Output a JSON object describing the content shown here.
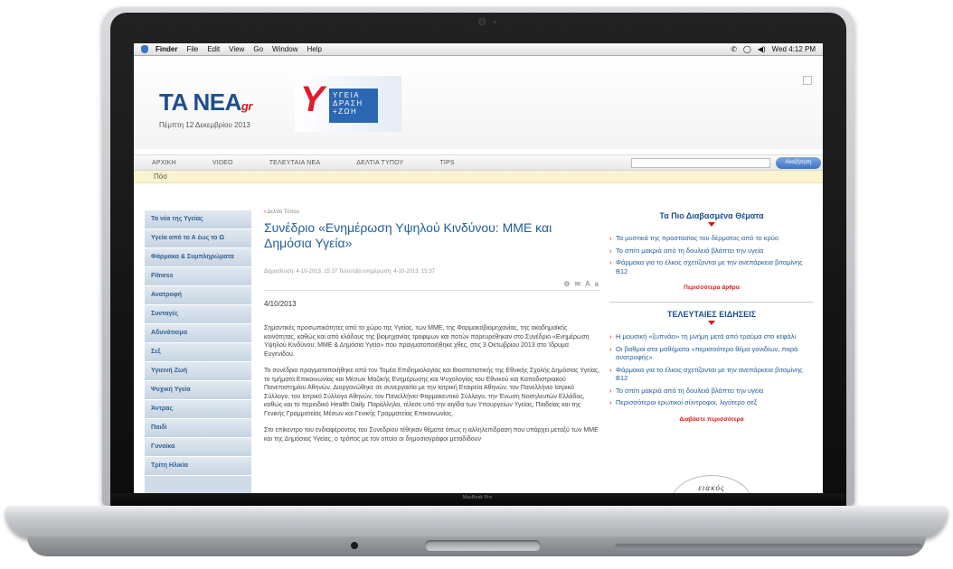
{
  "menubar": {
    "items": [
      "Finder",
      "File",
      "Edit",
      "View",
      "Go",
      "Window",
      "Help"
    ],
    "clock": "Wed 4:12 PM"
  },
  "site": {
    "logo": "TA NEA",
    "logo_suffix": "gr",
    "date": "Πέμπτη 12 Δεκεμβρίου 2013",
    "banner_letter": "Υ",
    "banner_lines": [
      "ΥΓΕΙΑ",
      "ΔΡΑΣΗ",
      "+ΖΩΗ"
    ]
  },
  "nav": {
    "items": [
      "ΑΡΧΙΚΗ",
      "VIDEO",
      "ΤΕΛΕΥΤΑΙΑ ΝΕΑ",
      "ΔΕΛΤΙΑ ΤΥΠΟΥ",
      "TIPS"
    ],
    "search_button": "Αναζήτηση",
    "subnav": "Πόσ"
  },
  "sidebar": {
    "items": [
      "Τα νέα της Υγείας",
      "Υγεία από το Α έως το Ω",
      "Φάρμακα & Συμπληρώματα",
      "Fitness",
      "Ανατροφή",
      "Συνταγές",
      "Αδυνάτισμα",
      "Σεξ",
      "Υγιεινή Ζωή",
      "Ψυχική Υγεία",
      "Άντρας",
      "Παιδί",
      "Γυναίκα",
      "Τρίτη Ηλικία"
    ]
  },
  "article": {
    "crumb": "Δελτία Τύπου",
    "title": "Συνέδριο «Ενημέρωση Υψηλού Κινδύνου: ΜΜΕ και Δημόσια Υγεία»",
    "meta": "Δημοσίευση: 4-10-2013, 15:37 Τελευταία ενημέρωση: 4-10-2013, 15:37",
    "date": "4/10/2013",
    "paragraphs": [
      "Σημαντικές προσωπικότητες από το χώρο της Υγείας, των ΜΜΕ, της Φαρμακοβιομηχανίας, της ακαδημαϊκής κοινότητας, καθώς και από κλάδους της βιομηχανίας τροφίμων και ποτών παρευρέθηκαν στο Συνέδριο «Ενημέρωση Υψηλού Κινδύνου: ΜΜΕ & Δημόσια Υγεία» που πραγματοποιήθηκε χθες, στις 3 Οκτωβρίου 2013 στο Ίδρυμα Ευγενίδου.",
      "Το συνέδριο πραγματοποιήθηκε από τον Τομέα Επιδημιολογίας και Βιοστατιστικής της Εθνικής Σχολής Δημόσιας Υγείας, το τμήματα Επικοινωνίας και Μέσων Μαζικής Ενημέρωσης και Ψυχολογίας του Εθνικού και Καποδιστριακού Πανεπιστημίου Αθηνών. Διοργανώθηκε σε συνεργασία με την Ιατρική Εταιρεία Αθηνών, τον Πανελλήνιο Ιατρικό Σύλλογο, τον Ιατρικό Σύλλογο Αθηνών, τον Πανελλήνιο Φαρμακευτικό Σύλλογο, την Ένωση Νοσηλευτών Ελλάδος, καθώς και το περιοδικό Health Daily. Παράλληλα, τέλεσε υπό την αιγίδα των Υπουργείων Υγείας, Παιδείας και της Γενικής Γραμματείας Μέσων και Γενικής Γραμματείας Επικοινωνίας.",
      "Στο επίκεντρο του ενδιαφέροντος του Συνεδρίου τέθηκαν θέματα όπως η αλληλεπίδραση που υπάρχει μεταξύ των ΜΜΕ και της Δημόσιας Υγείας, ο τρόπος με τον οποίο οι δημοσιογράφοι μεταδίδουν"
    ]
  },
  "popular": {
    "title": "Τα Πιο Διαβασμένα Θέματα",
    "items": [
      "Τα μυστικά της προστασίας του δέρματος από το κρύο",
      "Το σπίτι μακριά από τη δουλειά βλάπτει την υγεία",
      "Φάρμακα για το έλκος σχετίζονται με την ανεπάρκεια βιταμίνης Β12"
    ],
    "more": "Περισσότερα άρθρα"
  },
  "latest": {
    "title": "ΤΕΛΕΥΤΑΙΕΣ ΕΙΔΗΣΕΙΣ",
    "items": [
      "Η μουσική «ξυπνάει» τη μνήμη μετά από τραύμα στο κεφάλι",
      "Οι βαθμοί στα μαθήματα «περισσότερο θέμα γονιδίων, παρά ανατροφής»",
      "Φάρμακα για το έλκος σχετίζονται με την ανεπάρκεια βιταμίνης Β12",
      "Το σπίτι μακριά από τη δουλειά βλάπτει την υγεία",
      "Περισσότεροι ερωτικοί σύντροφοι, λιγότερο σεξ"
    ],
    "more": "Διαβάστε περισσότερα"
  },
  "ad": {
    "text": "ειακός"
  },
  "laptop": {
    "label": "MacBook Pro"
  }
}
